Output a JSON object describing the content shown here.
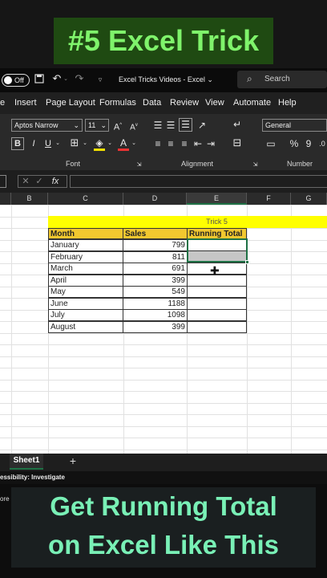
{
  "overlay": {
    "title": "#5 Excel Trick",
    "caption_line1": "Get Running Total",
    "caption_line2": "on Excel Like This"
  },
  "titlebar": {
    "autosave": "Off",
    "doc_title": "Excel Tricks Videos",
    "app": "Excel",
    "search_placeholder": "Search"
  },
  "menu": [
    "e",
    "Insert",
    "Page Layout",
    "Formulas",
    "Data",
    "Review",
    "View",
    "Automate",
    "Help"
  ],
  "ribbon": {
    "font_name": "Aptos Narrow",
    "font_size": "11",
    "number_format": "General",
    "group_font": "Font",
    "group_alignment": "Alignment",
    "group_number": "Number"
  },
  "formula": {
    "fx": "fx"
  },
  "columns": [
    "B",
    "C",
    "D",
    "E",
    "F",
    "G"
  ],
  "sheet": {
    "trick_label": "Trick 5",
    "headers": [
      "Month",
      "Sales",
      "Running Total"
    ],
    "rows": [
      {
        "month": "January",
        "sales": "799"
      },
      {
        "month": "February",
        "sales": "811"
      },
      {
        "month": "March",
        "sales": "691"
      },
      {
        "month": "April",
        "sales": "399"
      },
      {
        "month": "May",
        "sales": "549"
      },
      {
        "month": "June",
        "sales": "1188"
      },
      {
        "month": "July",
        "sales": "1098"
      },
      {
        "month": "August",
        "sales": "399"
      }
    ]
  },
  "tabs": {
    "sheet1": "Sheet1",
    "add": "+"
  },
  "status": {
    "accessibility": "essibility: Investigate",
    "left": "ore"
  },
  "colors": {
    "accent_green": "#1e7145",
    "header_fill": "#f2c82f",
    "trick_fill": "#ffff00",
    "selection": "#c6c6c6"
  }
}
